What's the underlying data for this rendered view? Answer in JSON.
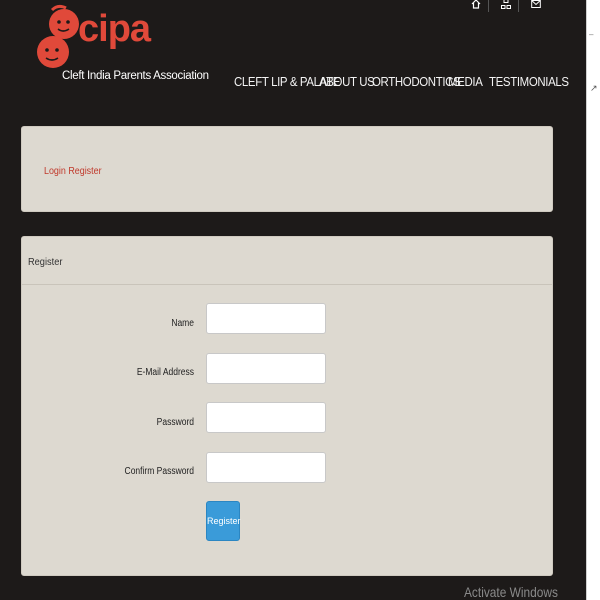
{
  "brand": {
    "word": "cipa",
    "subtitle": "Cleft India Parents Association",
    "accent": "#e0493a"
  },
  "top_icons": [
    "home-icon",
    "sitemap-icon",
    "mail-icon"
  ],
  "nav": {
    "items": [
      {
        "label": "CLEFT LIP & PALATE"
      },
      {
        "label": "ABOUT US"
      },
      {
        "label": "ORTHODONTICS"
      },
      {
        "label": "MEDIA"
      },
      {
        "label": "TESTIMONIALS"
      }
    ]
  },
  "breadcrumb": {
    "login": "Login",
    "register": "Register"
  },
  "register_panel": {
    "title": "Register",
    "fields": [
      {
        "label": "Name",
        "value": ""
      },
      {
        "label": "E-Mail Address",
        "value": ""
      },
      {
        "label": "Password",
        "value": ""
      },
      {
        "label": "Confirm Password",
        "value": ""
      }
    ],
    "button": "Register"
  },
  "watermark": "Activate Windows"
}
